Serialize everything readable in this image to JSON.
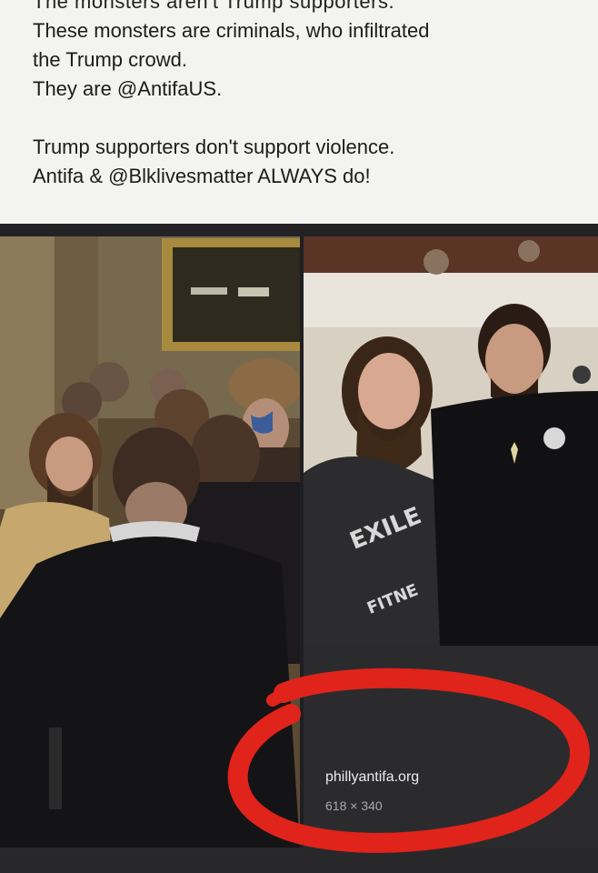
{
  "post": {
    "cut_line": "The monsters aren't Trump supporters.",
    "line1": "These monsters are criminals, who infiltrated",
    "line2": "the Trump crowd.",
    "line3": "They are @AntifaUS.",
    "line4": "Trump supporters don't support violence.",
    "line5": "Antifa & @Blklivesmatter ALWAYS do!"
  },
  "right_photo": {
    "shirt_text_top": "EXILE",
    "shirt_text_bottom": "FITNE"
  },
  "source": {
    "url": "phillyantifa.org",
    "dimensions": "618 × 340"
  },
  "colors": {
    "circle_annotation": "#e0231b",
    "source_card_bg": "#2b2b2d",
    "post_bg": "#f3f3f1"
  },
  "icons": [
    "red-circle-annotation"
  ]
}
